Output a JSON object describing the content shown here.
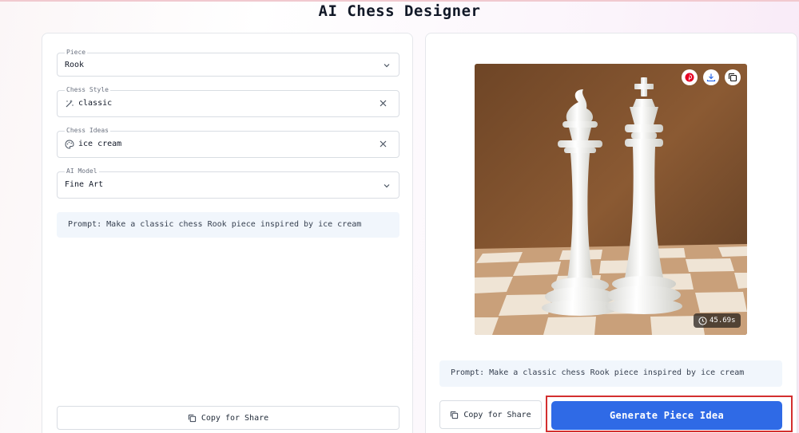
{
  "page": {
    "title": "AI Chess Designer"
  },
  "form": {
    "piece": {
      "label": "Piece",
      "value": "Rook"
    },
    "style": {
      "label": "Chess Style",
      "value": "classic"
    },
    "ideas": {
      "label": "Chess Ideas",
      "value": "ice cream"
    },
    "model": {
      "label": "AI Model",
      "value": "Fine Art"
    },
    "prompt": "Prompt: Make a classic chess Rook piece inspired by ice cream",
    "share_label": "Copy for Share"
  },
  "result": {
    "timer": "45.69s",
    "prompt": "Prompt: Make a classic chess Rook piece inspired by ice cream",
    "share_label": "Copy for Share",
    "generate_label": "Generate Piece Idea"
  },
  "colors": {
    "accent": "#2f6ae6",
    "highlight": "#d32f2f",
    "prompt_bg": "#f1f6fc"
  }
}
